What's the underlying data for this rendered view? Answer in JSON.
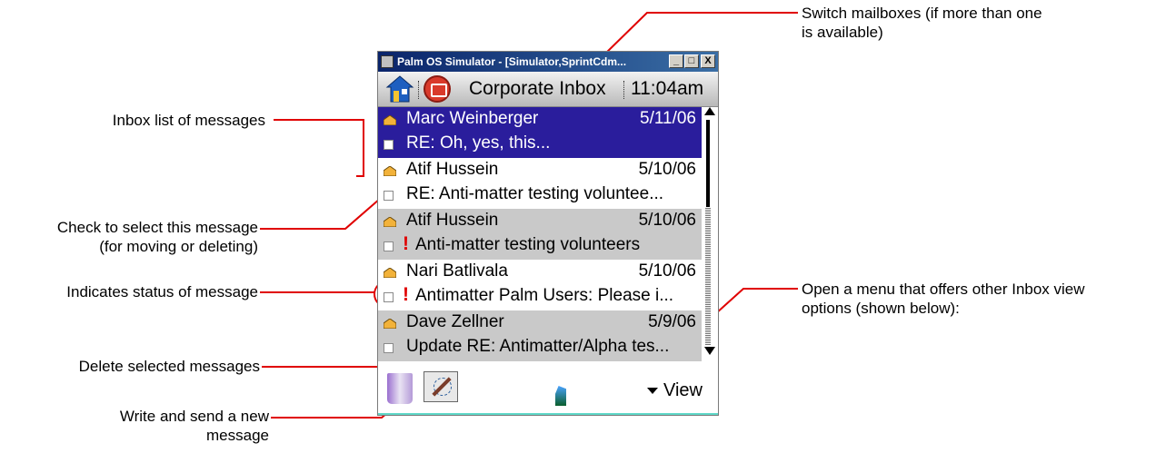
{
  "annotations": {
    "switch_mailboxes": "Switch mailboxes (if more than one is available)",
    "switch_mailboxes_line1": "Switch mailboxes (if more than one",
    "switch_mailboxes_line2": "is available)",
    "inbox_list": "Inbox list of messages",
    "check_select_line1": "Check to select this message",
    "check_select_line2": "(for moving or deleting)",
    "status": "Indicates status of message",
    "view_menu_line1": "Open a menu that offers other Inbox view",
    "view_menu_line2": "options (shown below):",
    "delete": "Delete selected messages",
    "write_line1": "Write and send a new",
    "write_line2": "message"
  },
  "window": {
    "title": "Palm OS Simulator - [Simulator,SprintCdm...",
    "buttons": [
      "_",
      "□",
      "X"
    ]
  },
  "header": {
    "mailbox": "Corporate Inbox",
    "time": "11:04am",
    "home_icon": "home-icon",
    "mail_icon": "mail-app-icon"
  },
  "messages": [
    {
      "sender": "Marc Weinberger",
      "date": "5/11/06",
      "subject": "RE: Oh, yes, this...",
      "urgent": false,
      "selected": true
    },
    {
      "sender": "Atif Hussein",
      "date": "5/10/06",
      "subject": "RE: Anti-matter testing voluntee...",
      "urgent": false,
      "selected": false
    },
    {
      "sender": "Atif Hussein",
      "date": "5/10/06",
      "subject": "Anti-matter testing volunteers",
      "urgent": true,
      "selected": false
    },
    {
      "sender": "Nari Batlivala",
      "date": "5/10/06",
      "subject": "Antimatter Palm Users: Please i...",
      "urgent": true,
      "selected": false
    },
    {
      "sender": "Dave Zellner",
      "date": "5/9/06",
      "subject": "Update RE: Antimatter/Alpha tes...",
      "urgent": false,
      "selected": false
    }
  ],
  "urgent_mark": "!",
  "toolbar": {
    "view_label": "View",
    "delete_icon": "trash-icon",
    "compose_icon": "compose-icon",
    "signal_icon": "signal-icon"
  },
  "colors": {
    "selected_row": "#2a1d9c",
    "alt_row": "#c9c9c9",
    "leader_line": "#e00000",
    "urgent": "#e00000"
  }
}
